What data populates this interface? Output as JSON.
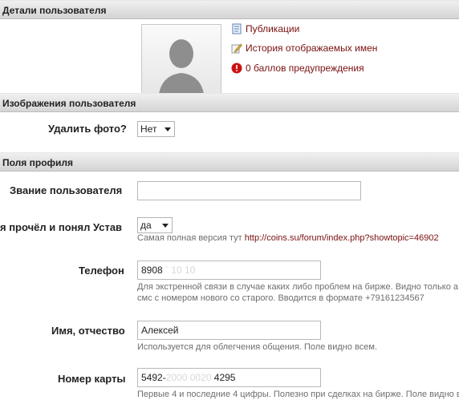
{
  "sections": {
    "user_details": "Детали пользователя",
    "user_images": "Изображения пользователя",
    "profile_fields": "Поля профиля"
  },
  "links": {
    "publications": "Публикации",
    "name_history": "История отображаемых имен",
    "warnings": "0 баллов предупреждения"
  },
  "delete_photo": {
    "label": "Удалить фото?",
    "value": "Нет"
  },
  "rank": {
    "label": "Звание пользователя",
    "value": ""
  },
  "charter": {
    "label": "я прочёл и понял Устав",
    "value": "да",
    "hint_prefix": "Самая полная версия тут",
    "hint_link": "http://coins.su/forum/index.php?showtopic=46902"
  },
  "phone": {
    "label": "Телефон",
    "value_visible": "8908 ",
    "value_masked": "` 10 10",
    "hint_line1": "Для экстренной связи в случае каких либо проблем на бирже. Видно только а",
    "hint_line2": "смс с номером нового со старого. Вводится в формате +79161234567"
  },
  "name": {
    "label": "Имя, отчество",
    "value": "Алексей",
    "hint": "Используется для облегчения общения. Поле видно всем."
  },
  "card": {
    "label": "Номер карты",
    "value_prefix": "5492-",
    "value_masked": "2000 0020 ",
    "value_suffix": "4295",
    "hint": "Первые 4 и последние 4 цифры. Полезно при сделках на бирже. Поле видно всем"
  },
  "colors": {
    "link": "#7a1010",
    "section_bar": "#d8d8d8",
    "warning_icon": "#cc1111"
  },
  "icons": [
    "document-icon",
    "pencil-icon",
    "warning-icon",
    "avatar-placeholder"
  ]
}
